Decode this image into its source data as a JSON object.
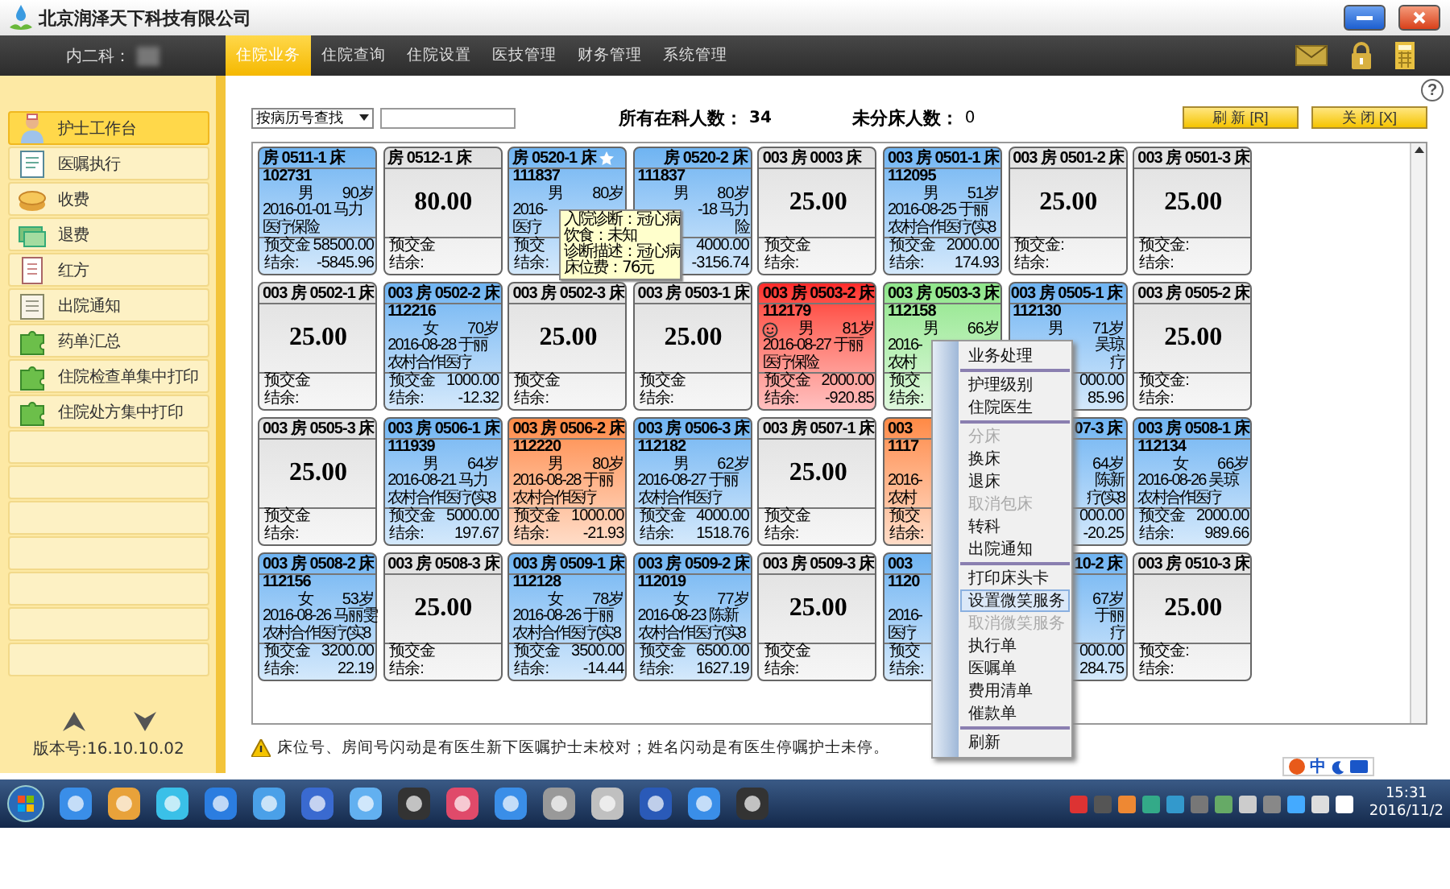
{
  "title_bar": {
    "company": "北京润泽天下科技有限公司"
  },
  "nav": {
    "department": "内二科：",
    "tabs": [
      {
        "label": "住院业务",
        "selected": true
      },
      {
        "label": "住院查询",
        "selected": false
      },
      {
        "label": "住院设置",
        "selected": false
      },
      {
        "label": "医技管理",
        "selected": false
      },
      {
        "label": "财务管理",
        "selected": false
      },
      {
        "label": "系统管理",
        "selected": false
      }
    ]
  },
  "help_button": "?",
  "sidebar": {
    "items": [
      {
        "label": "护士工作台",
        "selected": true
      },
      {
        "label": "医嘱执行",
        "selected": false
      },
      {
        "label": "收费",
        "selected": false
      },
      {
        "label": "退费",
        "selected": false
      },
      {
        "label": "红方",
        "selected": false
      },
      {
        "label": "出院通知",
        "selected": false
      },
      {
        "label": "药单汇总",
        "selected": false
      },
      {
        "label": "住院检查单集中打印",
        "selected": false
      },
      {
        "label": "住院处方集中打印",
        "selected": false
      }
    ],
    "version": "版本号:16.10.10.02"
  },
  "toolbar": {
    "search_mode": "按病历号查找",
    "total_label": "所有在科人数：",
    "total": "34",
    "unassigned_label": "未分床人数：",
    "unassigned": "0",
    "buttons": [
      "刷 新 [R]",
      "关 闭 [X]"
    ]
  },
  "grid": {
    "cards": [
      {
        "kind": "occupied",
        "header": "房 0511-1 床",
        "color": "#6fb4f2",
        "id": "102731",
        "gender": "男",
        "age": "90岁",
        "date": "2016-01-01 马力",
        "insurance": "医疗保险",
        "deposit_label": "预交金",
        "deposit": "58500.00",
        "balance_label": "结余:",
        "balance": "-5845.96"
      },
      {
        "kind": "empty",
        "header": "房 0512-1 床",
        "price": "80.00",
        "deposit_label": "预交金",
        "balance_label": "结余:"
      },
      {
        "kind": "occupied",
        "header": "房 0520-1 床",
        "starred": true,
        "color": "#6fb4f2",
        "id": "111837",
        "gender": "男",
        "age": "80岁",
        "date": "2016-",
        "insurance": "医疗",
        "deposit_label": "预交",
        "balance_label": "结余:"
      },
      {
        "kind": "occupied",
        "header": "房 0520-2 床",
        "covered_left": true,
        "color": "#6fb4f2",
        "id": "111837",
        "gender": "男",
        "age": "80岁",
        "date": "-18 马力",
        "insurance": "险",
        "deposit": "4000.00",
        "balance": "-3156.74"
      },
      {
        "kind": "empty",
        "header": "003 房 0003 床",
        "price": "25.00",
        "deposit_label": "预交金",
        "balance_label": "结余:"
      },
      {
        "kind": "occupied",
        "header": "003 房 0501-1 床",
        "color": "#6fb4f2",
        "id": "112095",
        "gender": "男",
        "age": "51岁",
        "date": "2016-08-25 于丽",
        "insurance": "农村合作医疗(实8",
        "deposit_label": "预交金",
        "deposit": "2000.00",
        "balance_label": "结余:",
        "balance": "174.93"
      },
      {
        "kind": "empty",
        "header": "003 房 0501-2 床",
        "price": "25.00",
        "deposit_label": "预交金:",
        "balance_label": "结余:"
      },
      {
        "kind": "empty",
        "header": "003 房 0501-3 床",
        "price": "25.00",
        "deposit_label": "预交金:",
        "balance_label": "结余:"
      },
      {
        "kind": "empty",
        "header": "003 房 0502-1 床",
        "price": "25.00",
        "deposit_label": "预交金",
        "balance_label": "结余:"
      },
      {
        "kind": "occupied",
        "header": "003 房 0502-2 床",
        "color": "#6fb4f2",
        "id": "112216",
        "gender": "女",
        "age": "70岁",
        "date": "2016-08-28 于丽",
        "insurance": "农村合作医疗",
        "deposit_label": "预交金",
        "deposit": "1000.00",
        "balance_label": "结余:",
        "balance": "-12.32"
      },
      {
        "kind": "empty",
        "header": "003 房 0502-3 床",
        "price": "25.00",
        "deposit_label": "预交金",
        "balance_label": "结余:"
      },
      {
        "kind": "empty",
        "header": "003 房 0503-1 床",
        "price": "25.00",
        "deposit_label": "预交金",
        "balance_label": "结余:"
      },
      {
        "kind": "occupied",
        "header": "003 房 0503-2 床",
        "smile_service": true,
        "color": "#ff2a2a",
        "id": "112179",
        "gender": "男",
        "age": "81岁",
        "date": "2016-08-27 于丽",
        "insurance": "医疗保险",
        "deposit_label": "预交金",
        "deposit": "2000.00",
        "balance_label": "结余:",
        "balance": "-920.85"
      },
      {
        "kind": "occupied",
        "header": "003 房 0503-3 床",
        "color": "#8fe68a",
        "id": "112158",
        "gender": "男",
        "age": "66岁",
        "date": "2016-",
        "insurance": "农村",
        "deposit_label": "预交",
        "balance_label": "结余:"
      },
      {
        "kind": "occupied",
        "header": "003 房 0505-1 床",
        "covered_left": true,
        "color": "#6fb4f2",
        "id": "112130",
        "gender": "男",
        "age": "71岁",
        "date": "吴琼",
        "insurance": "疗",
        "deposit": "000.00",
        "balance": "85.96"
      },
      {
        "kind": "empty",
        "header": "003 房 0505-2 床",
        "price": "25.00",
        "deposit_label": "预交金:",
        "balance_label": "结余:"
      },
      {
        "kind": "empty",
        "header": "003 房 0505-3 床",
        "price": "25.00",
        "deposit_label": "预交金",
        "balance_label": "结余:"
      },
      {
        "kind": "occupied",
        "header": "003 房 0506-1 床",
        "color": "#6fb4f2",
        "id": "111939",
        "gender": "男",
        "age": "64岁",
        "date": "2016-08-21 马力",
        "insurance": "农村合作医疗(实8",
        "deposit_label": "预交金",
        "deposit": "5000.00",
        "balance_label": "结余:",
        "balance": "197.67"
      },
      {
        "kind": "occupied",
        "header": "003 房 0506-2 床",
        "color": "#ff8a45",
        "id": "112220",
        "gender": "男",
        "age": "80岁",
        "date": "2016-08-28 于丽",
        "insurance": "农村合作医疗",
        "deposit_label": "预交金",
        "deposit": "1000.00",
        "balance_label": "结余:",
        "balance": "-21.93"
      },
      {
        "kind": "occupied",
        "header": "003 房 0506-3 床",
        "color": "#6fb4f2",
        "id": "112182",
        "gender": "男",
        "age": "62岁",
        "date": "2016-08-27 于丽",
        "insurance": "农村合作医疗",
        "deposit_label": "预交金",
        "deposit": "4000.00",
        "balance_label": "结余:",
        "balance": "1518.76"
      },
      {
        "kind": "empty",
        "header": "003 房 0507-1 床",
        "price": "25.00",
        "deposit_label": "预交金",
        "balance_label": "结余:"
      },
      {
        "kind": "occupied",
        "header": "003",
        "color": "#ff8a45",
        "id": "1117",
        "date": "2016-",
        "insurance": "农村",
        "deposit_label": "预交",
        "balance_label": "结余:"
      },
      {
        "kind": "occupied",
        "header": "07-3 床",
        "covered_left": true,
        "color": "#6fb4f2",
        "age": "64岁",
        "date": "陈新",
        "insurance": "疗(实8",
        "deposit": "000.00",
        "balance": "-20.25"
      },
      {
        "kind": "occupied",
        "header": "003 房 0508-1 床",
        "color": "#6fb4f2",
        "id": "112134",
        "gender": "女",
        "age": "66岁",
        "date": "2016-08-26 吴琼",
        "insurance": "农村合作医疗",
        "deposit_label": "预交金",
        "deposit": "2000.00",
        "balance_label": "结余:",
        "balance": "989.66"
      },
      {
        "kind": "occupied",
        "header": "003 房 0508-2 床",
        "color": "#6fb4f2",
        "id": "112156",
        "gender": "女",
        "age": "53岁",
        "date": "2016-08-26 马丽雯",
        "insurance": "农村合作医疗(实8",
        "deposit_label": "预交金",
        "deposit": "3200.00",
        "balance_label": "结余:",
        "balance": "22.19"
      },
      {
        "kind": "empty",
        "header": "003 房 0508-3 床",
        "price": "25.00",
        "deposit_label": "预交金",
        "balance_label": "结余:"
      },
      {
        "kind": "occupied",
        "header": "003 房 0509-1 床",
        "color": "#6fb4f2",
        "id": "112128",
        "gender": "女",
        "age": "78岁",
        "date": "2016-08-26 于丽",
        "insurance": "农村合作医疗(实8",
        "deposit_label": "预交金",
        "deposit": "3500.00",
        "balance_label": "结余:",
        "balance": "-14.44"
      },
      {
        "kind": "occupied",
        "header": "003 房 0509-2 床",
        "color": "#6fb4f2",
        "id": "112019",
        "gender": "女",
        "age": "77岁",
        "date": "2016-08-23 陈新",
        "insurance": "农村合作医疗(实8",
        "deposit_label": "预交金",
        "deposit": "6500.00",
        "balance_label": "结余:",
        "balance": "1627.19"
      },
      {
        "kind": "empty",
        "header": "003 房 0509-3 床",
        "price": "25.00",
        "deposit_label": "预交金",
        "balance_label": "结余:"
      },
      {
        "kind": "occupied",
        "header": "003",
        "color": "#6fb4f2",
        "id": "1120",
        "date": "2016-",
        "insurance": "医疗",
        "deposit_label": "预交",
        "balance_label": "结余:"
      },
      {
        "kind": "occupied",
        "header": "10-2 床",
        "covered_left": true,
        "color": "#6fb4f2",
        "age": "67岁",
        "date": "于丽",
        "insurance": "疗",
        "deposit": "000.00",
        "balance": "284.75"
      },
      {
        "kind": "empty",
        "header": "003 房 0510-3 床",
        "price": "25.00",
        "deposit_label": "预交金:",
        "balance_label": "结余:"
      }
    ]
  },
  "tooltip": {
    "lines": [
      "入院诊断：冠心病",
      "饮食：未知",
      "诊断描述：冠心病",
      "床位费：76元"
    ]
  },
  "context_menu": {
    "items": [
      {
        "kind": "item",
        "label": "业务处理",
        "disabled": false,
        "selected": false
      },
      {
        "kind": "separator"
      },
      {
        "kind": "item",
        "label": "护理级别",
        "disabled": false,
        "selected": false
      },
      {
        "kind": "item",
        "label": "住院医生",
        "disabled": false,
        "selected": false
      },
      {
        "kind": "separator"
      },
      {
        "kind": "item",
        "label": "分床",
        "disabled": true,
        "selected": false
      },
      {
        "kind": "item",
        "label": "换床",
        "disabled": false,
        "selected": false
      },
      {
        "kind": "item",
        "label": "退床",
        "disabled": false,
        "selected": false
      },
      {
        "kind": "item",
        "label": "取消包床",
        "disabled": true,
        "selected": false
      },
      {
        "kind": "item",
        "label": "转科",
        "disabled": false,
        "selected": false
      },
      {
        "kind": "item",
        "label": "出院通知",
        "disabled": false,
        "selected": false
      },
      {
        "kind": "separator"
      },
      {
        "kind": "item",
        "label": "打印床头卡",
        "disabled": false,
        "selected": false
      },
      {
        "kind": "item",
        "label": "设置微笑服务",
        "disabled": false,
        "selected": true
      },
      {
        "kind": "item",
        "label": "取消微笑服务",
        "disabled": true,
        "selected": false
      },
      {
        "kind": "item",
        "label": "执行单",
        "disabled": false,
        "selected": false
      },
      {
        "kind": "item",
        "label": "医嘱单",
        "disabled": false,
        "selected": false
      },
      {
        "kind": "item",
        "label": "费用清单",
        "disabled": false,
        "selected": false
      },
      {
        "kind": "item",
        "label": "催款单",
        "disabled": false,
        "selected": false
      },
      {
        "kind": "separator"
      },
      {
        "kind": "item",
        "label": "刷新",
        "disabled": false,
        "selected": false
      }
    ]
  },
  "notice": "床位号、房间号闪动是有医生新下医嘱护士未校对；姓名闪动是有医生停嘱护士未停。",
  "ime_bar": {
    "mode": "中"
  },
  "taskbar": {
    "time": "15:31",
    "date": "2016/11/2"
  }
}
